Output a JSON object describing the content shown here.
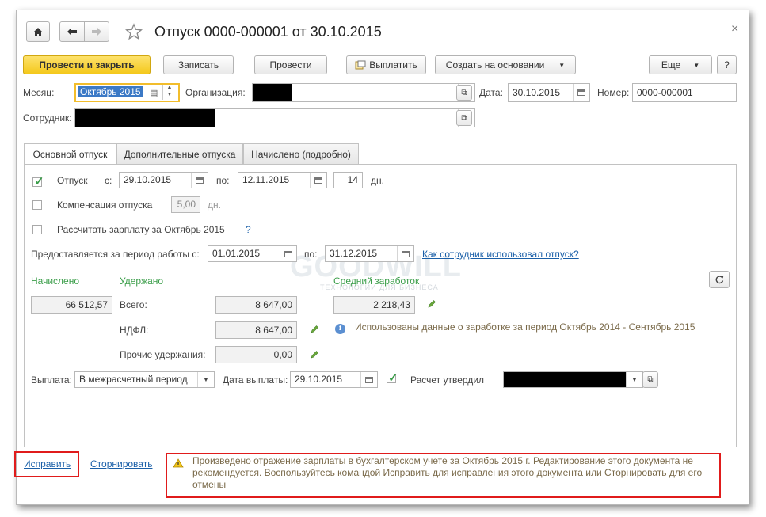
{
  "window": {
    "title": "Отпуск 0000-000001 от 30.10.2015",
    "close": "×"
  },
  "toolbar": {
    "post_close": "Провести и закрыть",
    "save": "Записать",
    "post": "Провести",
    "pay": "Выплатить",
    "create_based": "Создать на основании",
    "more": "Еще",
    "help": "?"
  },
  "header": {
    "month_label": "Месяц:",
    "month_value": "Октябрь 2015",
    "org_label": "Организация:",
    "date_label": "Дата:",
    "date_value": "30.10.2015",
    "number_label": "Номер:",
    "number_value": "0000-000001",
    "employee_label": "Сотрудник:"
  },
  "tabs": [
    "Основной отпуск",
    "Дополнительные отпуска",
    "Начислено (подробно)"
  ],
  "vacation": {
    "label": "Отпуск",
    "from_label": "с:",
    "from": "29.10.2015",
    "to_label": "по:",
    "to": "12.11.2015",
    "days": "14",
    "days_unit": "дн.",
    "compensation_label": "Компенсация отпуска",
    "compensation_days": "5,00",
    "compensation_unit": "дн.",
    "recalc_label": "Рассчитать зарплату за Октябрь 2015",
    "recalc_help": "?",
    "period_label": "Предоставляется за период работы с:",
    "period_from": "01.01.2015",
    "period_to_label": "по:",
    "period_to": "31.12.2015",
    "usage_link": "Как сотрудник использовал отпуск?"
  },
  "totals": {
    "accrued_label": "Начислено",
    "accrued_value": "66 512,57",
    "withheld_label": "Удержано",
    "total_label": "Всего:",
    "total_value": "8 647,00",
    "ndfl_label": "НДФЛ:",
    "ndfl_value": "8 647,00",
    "other_label": "Прочие удержания:",
    "other_value": "0,00",
    "avg_label": "Средний заработок",
    "avg_value": "2 218,43",
    "info_text": "Использованы данные о заработке за период Октябрь 2014 - Сентябрь 2015"
  },
  "payment": {
    "label": "Выплата:",
    "value": "В межрасчетный период",
    "date_label": "Дата выплаты:",
    "date_value": "29.10.2015",
    "approved_label": "Расчет утвердил"
  },
  "watermark": {
    "brand": "GOODWILL",
    "tagline": "ТЕХНОЛОГИИ ДЛЯ БИЗНЕСА"
  },
  "footer": {
    "fix_link": "Исправить",
    "reverse_link": "Сторнировать",
    "warning": "Произведено отражение зарплаты в бухгалтерском учете за Октябрь 2015 г. Редактирование этого документа не рекомендуется. Воспользуйтесь командой Исправить для исправления этого документа или Сторнировать для его отмены"
  },
  "colors": {
    "accent_yellow": "#f4c81b",
    "section_green": "#3b9e4a",
    "link_blue": "#1a5fa8",
    "highlight_red": "#e01b1b"
  }
}
